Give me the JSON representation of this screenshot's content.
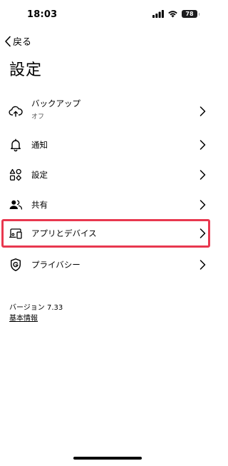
{
  "status_bar": {
    "time": "18:03",
    "battery": "78",
    "icons": [
      "signal-icon",
      "wifi-icon",
      "battery-icon"
    ]
  },
  "nav": {
    "back_label": "戻る",
    "back_icon": "chevron-left-icon"
  },
  "page": {
    "title": "設定"
  },
  "menu": {
    "items": [
      {
        "label": "バックアップ",
        "sublabel": "オフ",
        "icon": "cloud-upload-icon"
      },
      {
        "label": "通知",
        "icon": "bell-icon"
      },
      {
        "label": "設定",
        "icon": "shapes-icon"
      },
      {
        "label": "共有",
        "icon": "people-icon"
      },
      {
        "label": "アプリとデバイス",
        "icon": "devices-icon",
        "highlighted": true
      },
      {
        "label": "プライバシー",
        "icon": "shield-g-icon"
      }
    ]
  },
  "footer": {
    "version": "バージョン 7.33",
    "about_link": "基本情報"
  },
  "colors": {
    "highlight": "#e8384f",
    "text": "#000000",
    "background": "#ffffff"
  }
}
